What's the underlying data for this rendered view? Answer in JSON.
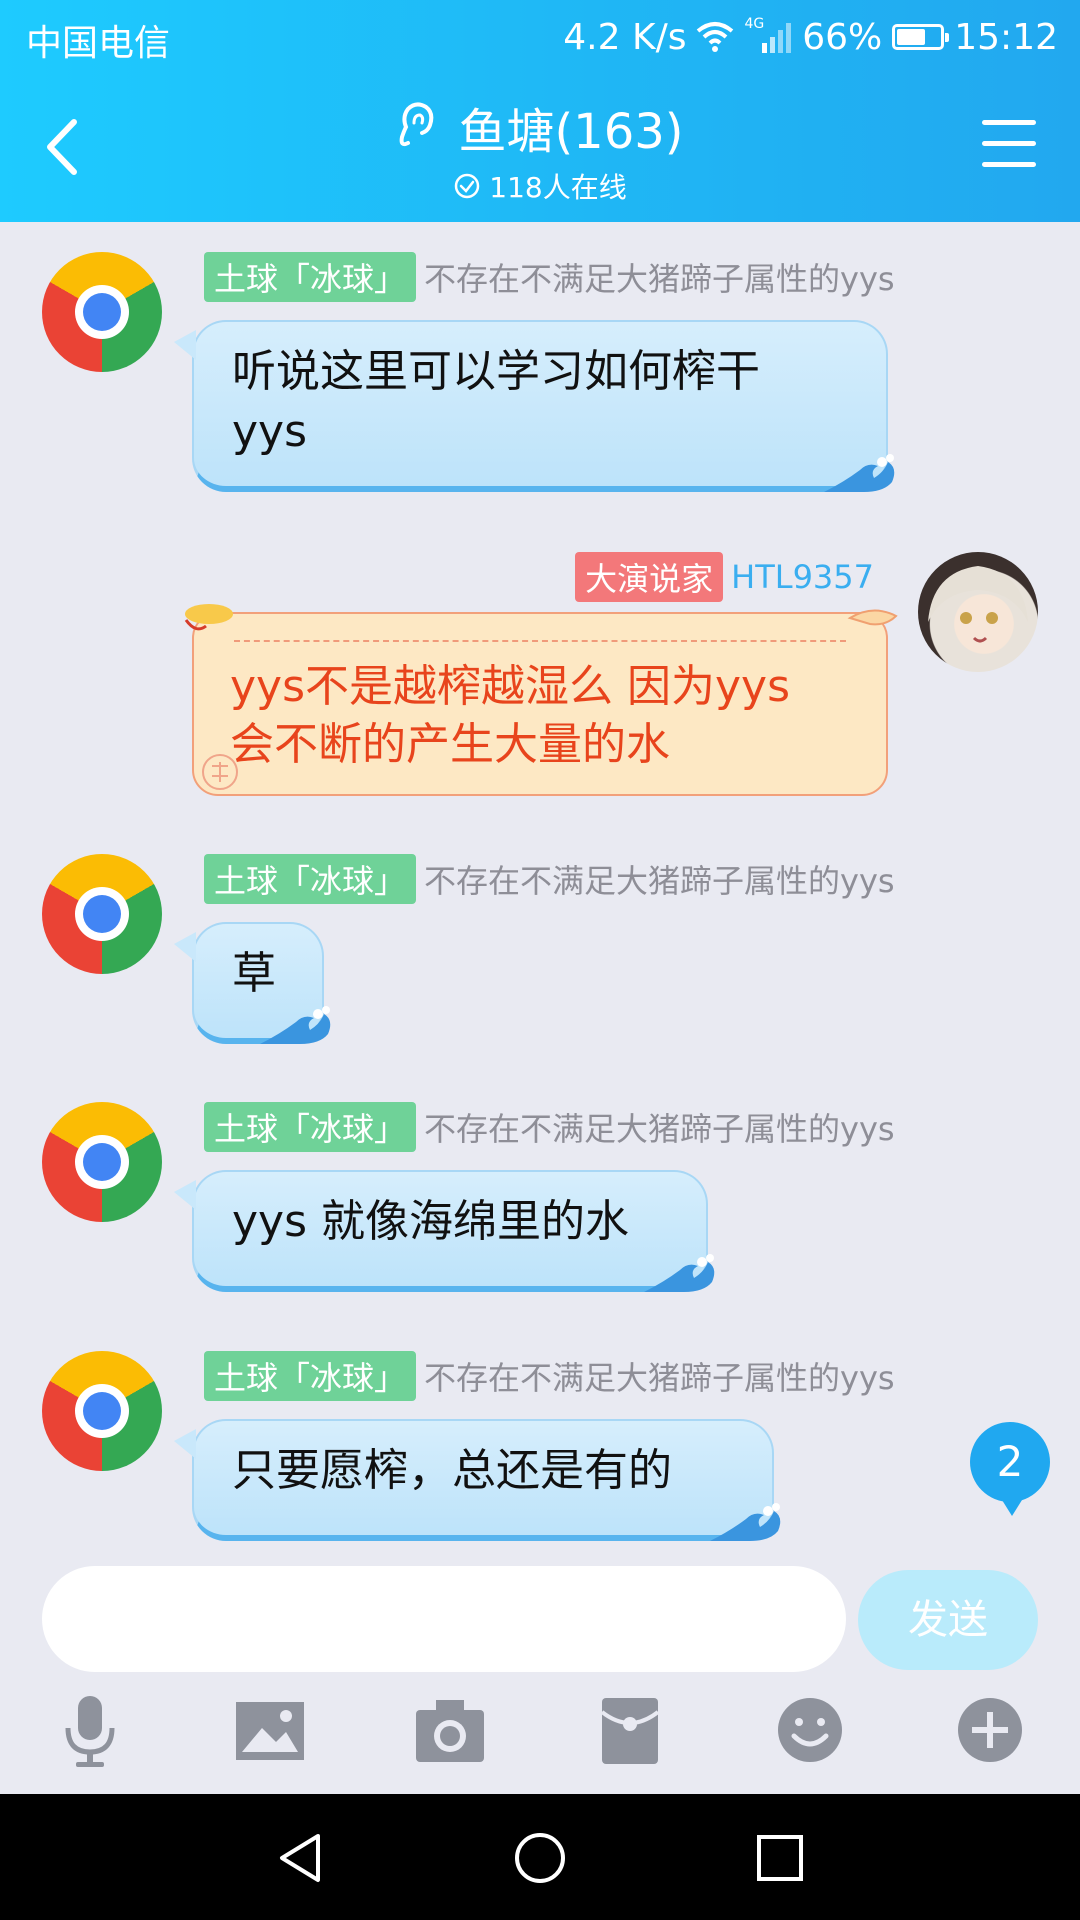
{
  "status_bar": {
    "carrier": "中国电信",
    "speed": "4.2 K/s",
    "network": "4G",
    "battery": "66%",
    "battery_level": 0.66,
    "time": "15:12"
  },
  "header": {
    "title": "鱼塘(163)",
    "online": "118人在线"
  },
  "messages": [
    {
      "tag": "土球「冰球」",
      "nick": "不存在不满足大猪蹄子属性的yys",
      "text1": "听说这里可以学习如何榨干",
      "text2": "yys"
    },
    {
      "tag": "大演说家",
      "nick": "HTL9357",
      "text1": "yys不是越榨越湿么 因为yys",
      "text2": "会不断的产生大量的水"
    },
    {
      "tag": "土球「冰球」",
      "nick": "不存在不满足大猪蹄子属性的yys",
      "text1": "草"
    },
    {
      "tag": "土球「冰球」",
      "nick": "不存在不满足大猪蹄子属性的yys",
      "text1": "yys 就像海绵里的水"
    },
    {
      "tag": "土球「冰球」",
      "nick": "不存在不满足大猪蹄子属性的yys",
      "text1": "只要愿榨，总还是有的"
    }
  ],
  "unread_count": "2",
  "input": {
    "value": "",
    "placeholder": ""
  },
  "send_label": "发送",
  "toolbar_icons": [
    "mic-icon",
    "image-icon",
    "camera-icon",
    "red-packet-icon",
    "emoji-icon",
    "plus-icon"
  ],
  "colors": {
    "header_blue": "#1fb7f5",
    "tag_green": "#6fd298",
    "tag_red": "#f3787a",
    "nick_blue": "#3aaef0",
    "orange_text": "#e8441c"
  }
}
